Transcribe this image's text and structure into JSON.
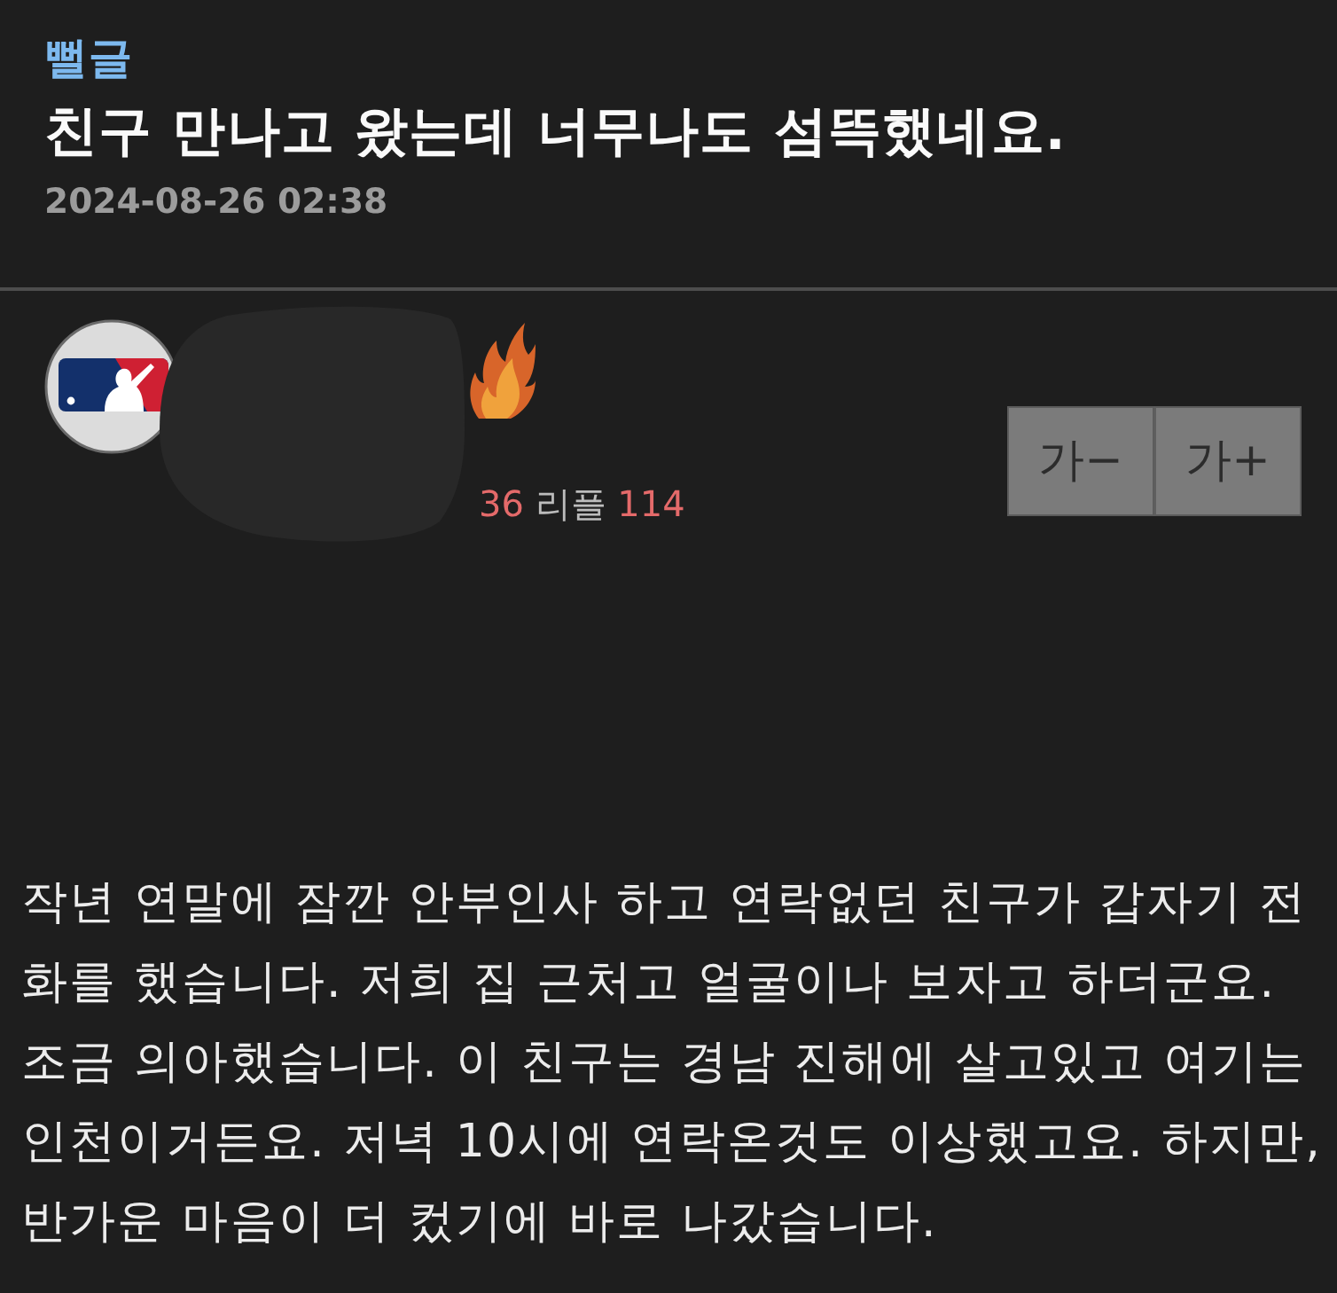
{
  "post": {
    "category": "뻘글",
    "title": "친구 만나고 왔는데 너무나도 섬뜩했네요.",
    "date": "2024-08-26 02:38"
  },
  "author": {
    "stats": [
      {
        "kind": "value",
        "text": "36"
      },
      {
        "kind": "label",
        "text": "리플"
      },
      {
        "kind": "value",
        "text": "114"
      }
    ]
  },
  "font_buttons": [
    {
      "label": "가−"
    },
    {
      "label": "가+"
    }
  ],
  "body": "작년 연말에 잠깐 안부인사 하고 연락없던 친구가 갑자기 전화를 했습니다. 저희 집 근처고 얼굴이나 보자고 하더군요. 조금 의아했습니다. 이 친구는 경남 진해에 살고있고 여기는 인천이거든요. 저녁 10시에 연락온것도 이상했고요. 하지만, 반가운 마음이 더 컸기에 바로 나갔습니다."
}
